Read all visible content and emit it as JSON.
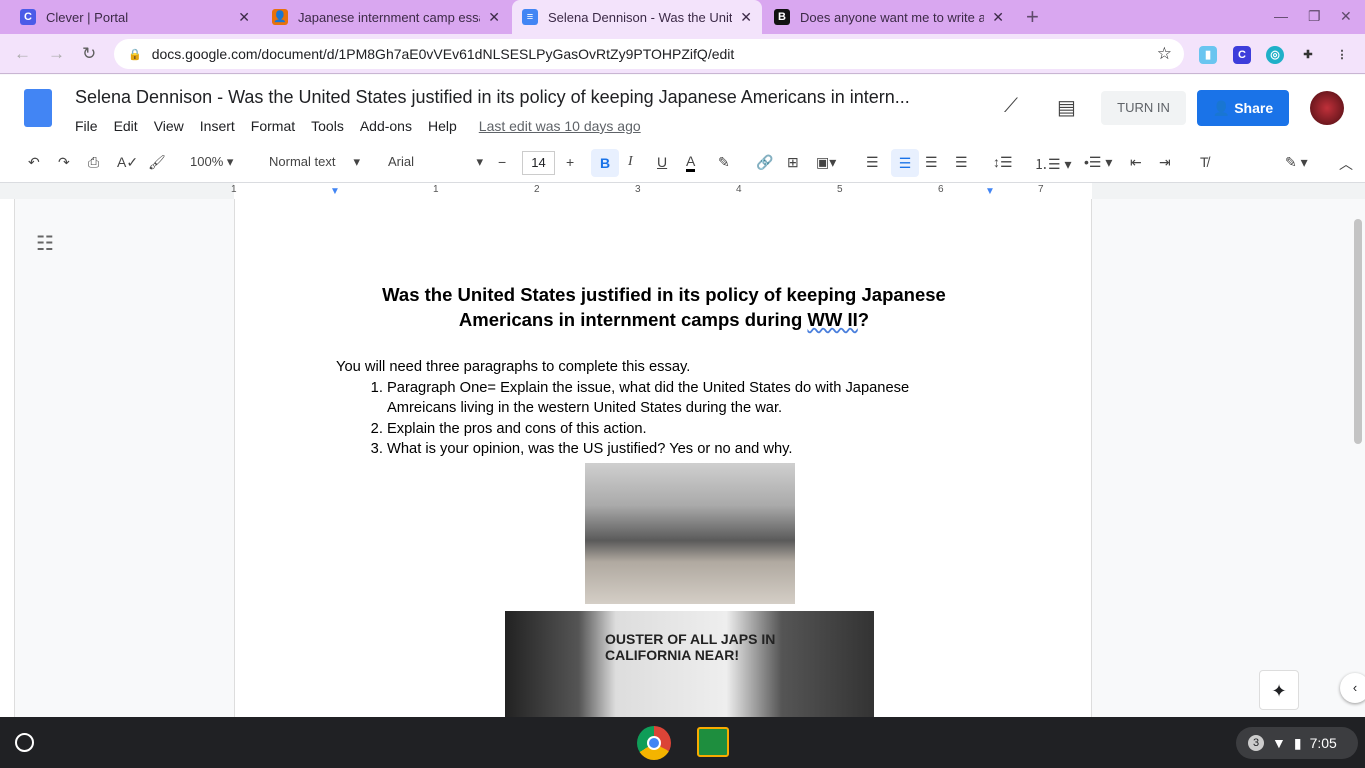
{
  "browser": {
    "tabs": [
      {
        "title": "Clever | Portal",
        "icon": "C",
        "color": "#4a5be8"
      },
      {
        "title": "Japanese internment camp essa",
        "icon": "👤",
        "color": "#e8710a"
      },
      {
        "title": "Selena Dennison - Was the Unite",
        "icon": "≡",
        "color": "#4285f4"
      },
      {
        "title": "Does anyone want me to write a",
        "icon": "B",
        "color": "#111111"
      }
    ],
    "new_tab": "+",
    "url": "docs.google.com/document/d/1PM8Gh7aE0vVEv61dNLSESLPyGasOvRtZy9PTOHPZifQ/edit"
  },
  "doc": {
    "title": "Selena Dennison - Was the United States justified in its policy of keeping Japanese Americans in intern...",
    "menu": [
      "File",
      "Edit",
      "View",
      "Insert",
      "Format",
      "Tools",
      "Add-ons",
      "Help"
    ],
    "last_edit": "Last edit was 10 days ago",
    "turn_in": "TURN IN",
    "share": "Share"
  },
  "toolbar": {
    "zoom": "100%",
    "style": "Normal text",
    "font": "Arial",
    "size": "14"
  },
  "ruler": [
    "1",
    "1",
    "2",
    "3",
    "4",
    "5",
    "6",
    "7"
  ],
  "content": {
    "heading_part1": "Was the United States justified in its policy of keeping Japanese Americans in internment camps during ",
    "heading_ww": "WW II",
    "heading_end": "?",
    "intro": "You will need three paragraphs to complete this essay.",
    "items": [
      "Paragraph One= Explain the issue, what did the United States do with Japanese Amreicans living in the western United States during the war.",
      "Explain the pros and cons of this action.",
      "What is your opinion, was the US justified? Yes or no and why."
    ],
    "newspaper_text": "OUSTER OF ALL JAPS IN CALIFORNIA NEAR!"
  },
  "taskbar": {
    "notifications": "3",
    "time": "7:05"
  }
}
